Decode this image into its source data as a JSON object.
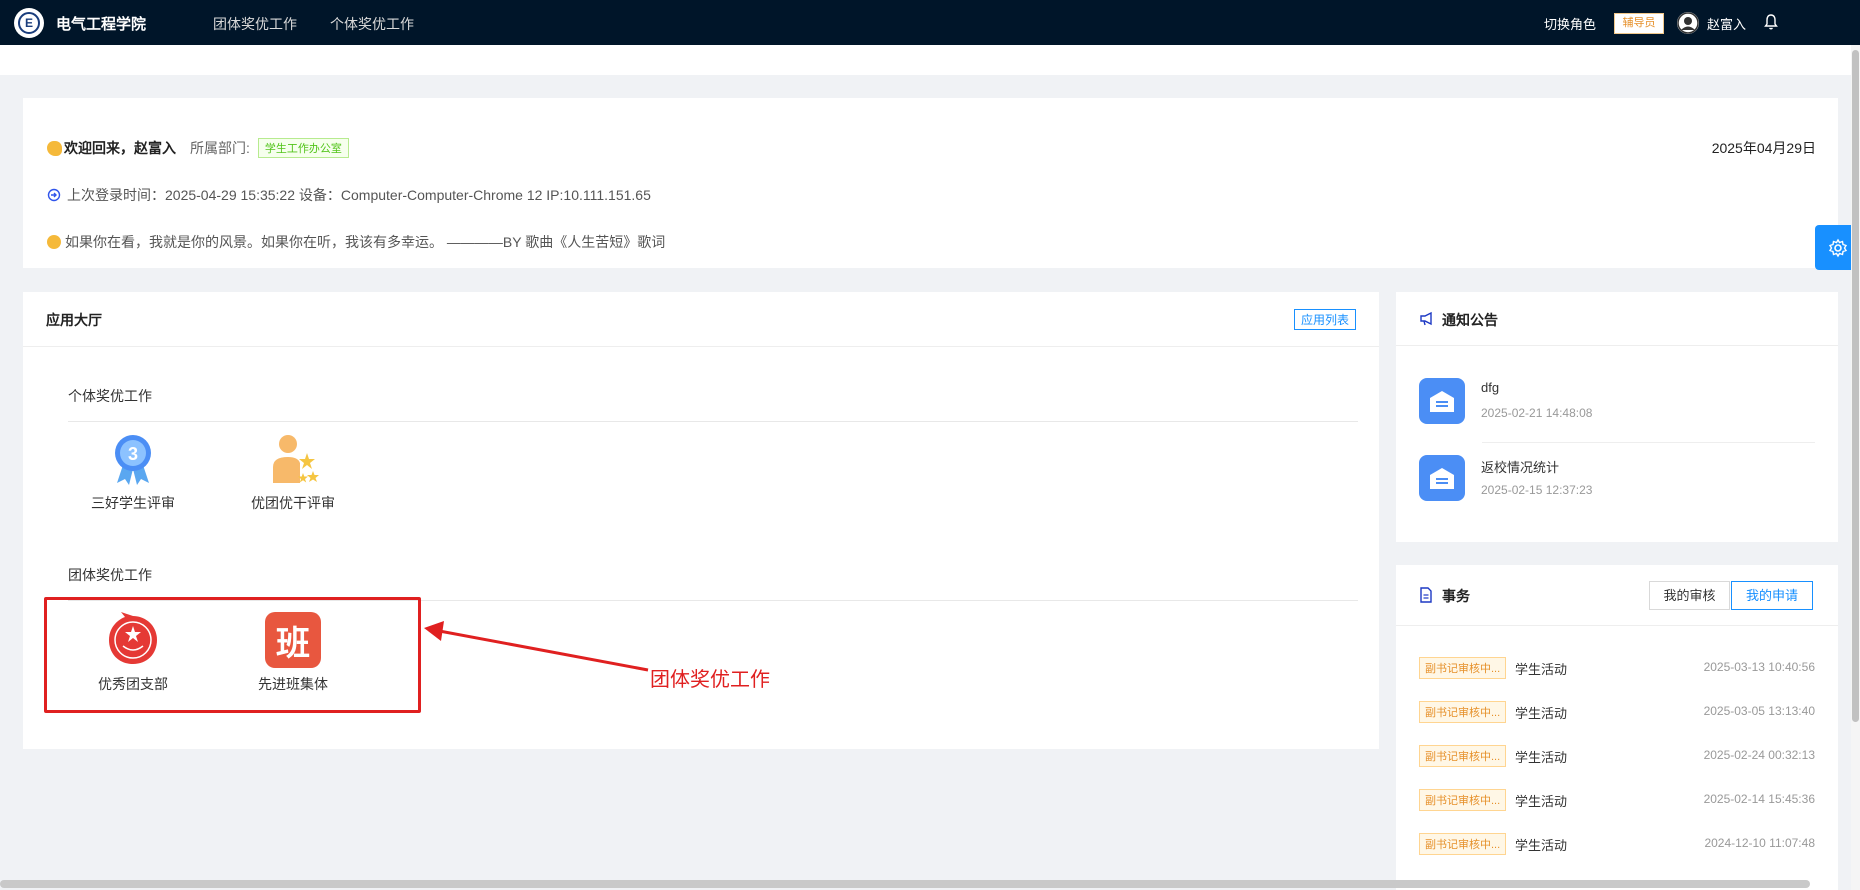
{
  "header": {
    "brand": "电气工程学院",
    "nav": [
      "团体奖优工作",
      "个体奖优工作"
    ],
    "switch_role": "切换角色",
    "role_tag": "辅导员",
    "username": "赵富入"
  },
  "welcome": {
    "greeting": "欢迎回来，赵富入",
    "dept_label": "所属部门:",
    "dept": "学生工作办公室",
    "date": "2025年04月29日",
    "login_info": "上次登录时间：2025-04-29 15:35:22  设备：Computer-Computer-Chrome 12  IP:10.111.151.65",
    "quote": "如果你在看，我就是你的风景。如果你在听，我该有多幸运。 ————BY 歌曲《人生苦短》歌词"
  },
  "apps": {
    "title": "应用大厅",
    "list_button": "应用列表",
    "sections": [
      {
        "title": "个体奖优工作",
        "items": [
          {
            "label": "三好学生评审",
            "icon": "medal-3-icon"
          },
          {
            "label": "优团优干评审",
            "icon": "person-stars-icon"
          }
        ]
      },
      {
        "title": "团体奖优工作",
        "items": [
          {
            "label": "优秀团支部",
            "icon": "league-emblem-icon"
          },
          {
            "label": "先进班集体",
            "icon": "ban-icon",
            "glyph": "班"
          }
        ]
      }
    ]
  },
  "annotation": {
    "text": "团体奖优工作",
    "color": "#e02020"
  },
  "notices": {
    "title": "通知公告",
    "items": [
      {
        "title": "dfg",
        "time": "2025-02-21 14:48:08"
      },
      {
        "title": "返校情况统计",
        "time": "2025-02-15 12:37:23"
      }
    ]
  },
  "affairs": {
    "title": "事务",
    "tabs": [
      "我的审核",
      "我的申请"
    ],
    "active_tab": "我的申请",
    "rows": [
      {
        "tag": "副书记审核中...",
        "name": "学生活动",
        "time": "2025-03-13 10:40:56"
      },
      {
        "tag": "副书记审核中...",
        "name": "学生活动",
        "time": "2025-03-05 13:13:40"
      },
      {
        "tag": "副书记审核中...",
        "name": "学生活动",
        "time": "2025-02-24 00:32:13"
      },
      {
        "tag": "副书记审核中...",
        "name": "学生活动",
        "time": "2025-02-14 15:45:36"
      },
      {
        "tag": "副书记审核中...",
        "name": "学生活动",
        "time": "2024-12-10 11:07:48"
      }
    ]
  },
  "colors": {
    "topbar": "#001529",
    "primary": "#1890ff",
    "annotation_red": "#e02020"
  }
}
